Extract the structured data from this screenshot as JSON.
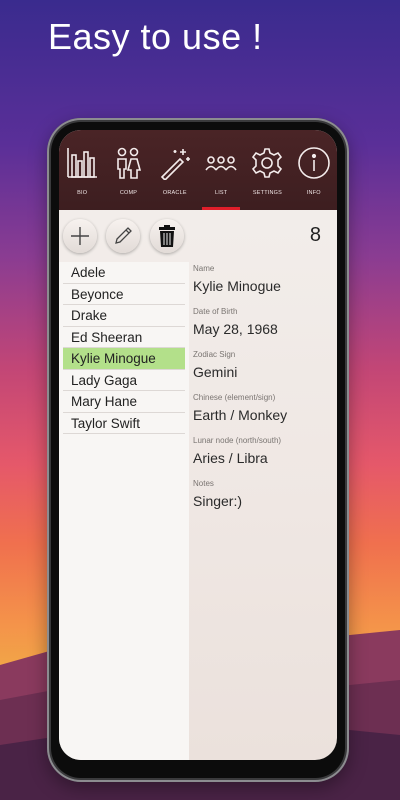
{
  "headline": "Easy to use !",
  "nav": [
    {
      "label": "BIO",
      "icon": "bar-chart-icon"
    },
    {
      "label": "COMP",
      "icon": "couple-icon"
    },
    {
      "label": "ORACLE",
      "icon": "magic-wand-icon"
    },
    {
      "label": "LIST",
      "icon": "group-icon",
      "active": true
    },
    {
      "label": "SETTINGS",
      "icon": "gear-icon"
    },
    {
      "label": "INFO",
      "icon": "info-icon"
    }
  ],
  "toolbar": {
    "add_icon": "plus-icon",
    "edit_icon": "pencil-icon",
    "delete_icon": "trash-icon",
    "count": "8"
  },
  "list": {
    "items": [
      "Adele",
      "Beyonce",
      "Drake",
      "Ed Sheeran",
      "Kylie Minogue",
      "Lady Gaga",
      "Mary Hane",
      "Taylor Swift"
    ],
    "selected": "Kylie Minogue"
  },
  "details": [
    {
      "label": "Name",
      "value": "Kylie Minogue"
    },
    {
      "label": "Date of Birth",
      "value": "May 28, 1968"
    },
    {
      "label": "Zodiac Sign",
      "value": "Gemini"
    },
    {
      "label": "Chinese (element/sign)",
      "value": "Earth / Monkey"
    },
    {
      "label": "Lunar node (north/south)",
      "value": "Aries / Libra"
    },
    {
      "label": "Notes",
      "value": "Singer:)"
    }
  ],
  "colors": {
    "navbar": "#3d1e20",
    "active_tab": "#e01e2a",
    "selected_row": "#b3e08a"
  }
}
